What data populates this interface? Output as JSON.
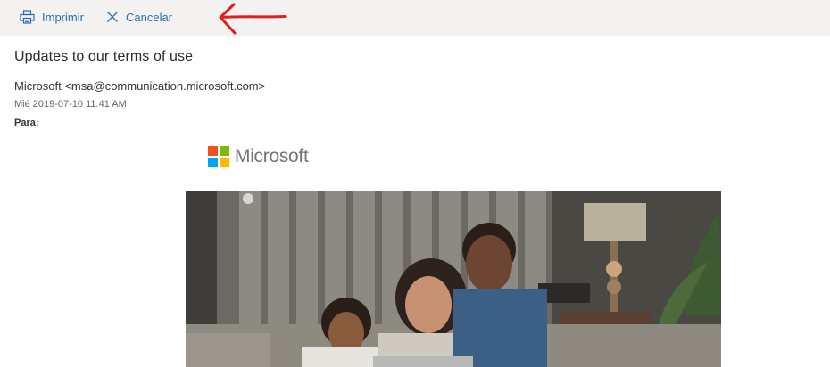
{
  "toolbar": {
    "print_label": "Imprimir",
    "cancel_label": "Cancelar",
    "print_icon": "printer-icon",
    "cancel_icon": "close-icon",
    "annotation_icon": "red-arrow-left-icon"
  },
  "message": {
    "subject": "Updates to our terms of use",
    "sender": "Microsoft <msa@communication.microsoft.com>",
    "date": "Mié 2019-07-10 11:41 AM",
    "to_label": "Para:"
  },
  "body": {
    "logo_text": "Microsoft",
    "logo_colors": [
      "#f25022",
      "#7fba00",
      "#00a4ef",
      "#ffb900"
    ],
    "hero_image": "family-on-couch-with-laptop-photo"
  },
  "colors": {
    "toolbar_bg": "#f3f2f1",
    "accent": "#2b6cb3",
    "annotation": "#e02020"
  }
}
